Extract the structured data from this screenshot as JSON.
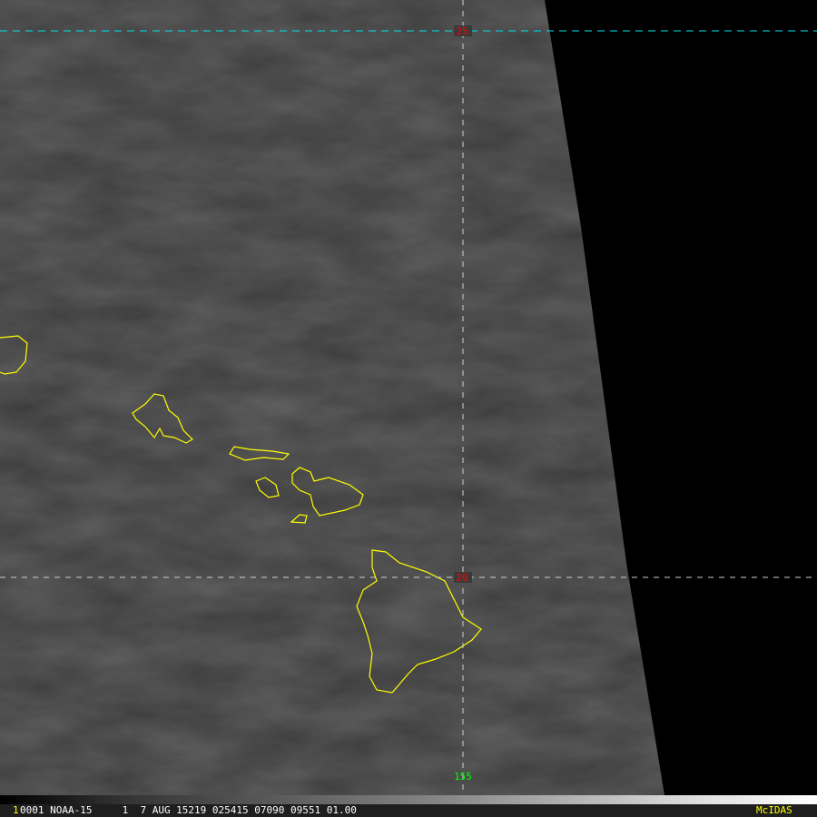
{
  "status_bar": {
    "frame": "1",
    "text": "0001 NOAA-15     1  7 AUG 15219 025415 07090 09551 01.00",
    "brand": "McIDAS"
  },
  "grid_labels": {
    "lat_25": "25",
    "lat_20": "20",
    "lon_155": "155"
  },
  "colors": {
    "coastline": "#ffff00",
    "lat_label": "#ff0000",
    "lon_label": "#00ff00",
    "grid_top": "#00e5ee",
    "grid": "#d0d0d0"
  }
}
